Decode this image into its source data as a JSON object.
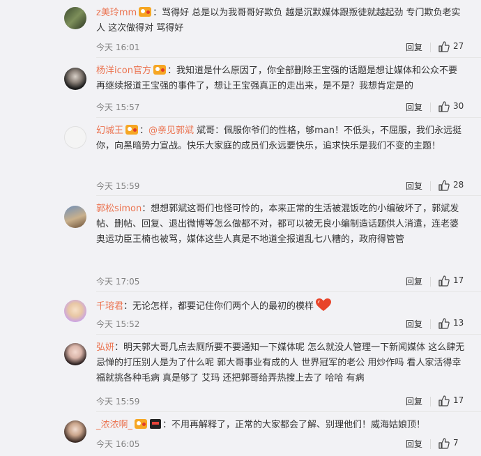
{
  "comments": [
    {
      "user": "z美玲mm",
      "text": "：骂得好  总是以为我哥哥好欺负  越是沉默媒体跟叛徒就越起劲    专门欺负老实人    这次做得对   骂得好",
      "time": "今天 16:01",
      "reply": "回复",
      "likes": "27"
    },
    {
      "user": "杨洋icon官方",
      "text": "：我知道是什么原因了，你全部删除王宝强的话题是想让媒体和公众不要再继续报道王宝强的事件了，想让王宝强真正的走出来，是不是？我想肯定是的",
      "time": "今天 15:57",
      "reply": "回复",
      "likes": "30"
    },
    {
      "user": "幻城王",
      "text_prefix": "：",
      "mention": "@亲见郭斌",
      "text": " 斌哥：佩服你爷们的性格，够man！不低头，不屈服，我们永远挺你，向黑暗势力宣战。快乐大家庭的成员们永远要快乐，追求快乐是我们不变的主题！",
      "time": "今天 15:59",
      "reply": "回复",
      "likes": "28"
    },
    {
      "user": "郭松simon",
      "text": "：想想郭斌这哥们也怪可怜的，本来正常的生活被混饭吃的小编破坏了，郭斌发帖、删帖、回复、退出微博等怎么做都不对，都可以被无良小编制造话题供人消遣，连老婆奥运功臣王楠也被骂，媒体这些人真是不地道全报道乱七八糟的，政府得管管",
      "time": "今天 17:05",
      "reply": "回复",
      "likes": "17"
    },
    {
      "user": "千瑢君",
      "text": "：无论怎样，都要记住你们两个人的最初的模样",
      "time": "今天 15:52",
      "reply": "回复",
      "likes": "13"
    },
    {
      "user": "弘妍",
      "text": "：明天郭大哥几点去厕所要不要通知一下媒体呢 怎么就没人管理一下新闻媒体 这么肆无忌惮的打压别人是为了什么呢 郭大哥事业有成的人 世界冠军的老公 用炒作吗 看人家活得幸福就挑各种毛病 真是够了 艾玛 还把郭哥给弄热搜上去了 哈哈 有病",
      "time": "今天 15:59",
      "reply": "回复",
      "likes": "17"
    },
    {
      "user": "_浓浓啊_",
      "text": "：不用再解释了，正常的大家都会了解、别理他们！威海姑娘顶！",
      "time": "今天 16:05",
      "reply": "回复",
      "likes": "7"
    }
  ],
  "colors": {
    "username": "#eb7350",
    "text": "#333333",
    "meta": "#808080",
    "background": "#f2f2f5"
  },
  "icons": {
    "like": "thumbs-up-icon",
    "badge": "vip-badge-icon",
    "heart": "heart-emoji-icon"
  }
}
